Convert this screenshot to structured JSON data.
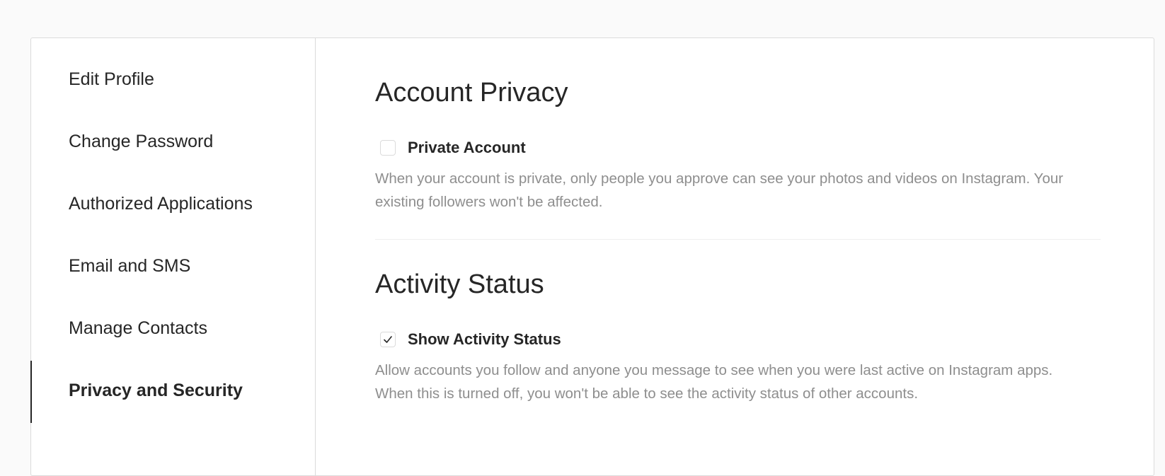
{
  "sidebar": {
    "items": [
      {
        "label": "Edit Profile"
      },
      {
        "label": "Change Password"
      },
      {
        "label": "Authorized Applications"
      },
      {
        "label": "Email and SMS"
      },
      {
        "label": "Manage Contacts"
      },
      {
        "label": "Privacy and Security",
        "active": true
      }
    ]
  },
  "account_privacy": {
    "title": "Account Privacy",
    "checkbox_label": "Private Account",
    "checked": false,
    "description": "When your account is private, only people you approve can see your photos and videos on Instagram. Your existing followers won't be affected."
  },
  "activity_status": {
    "title": "Activity Status",
    "checkbox_label": "Show Activity Status",
    "checked": true,
    "description": "Allow accounts you follow and anyone you message to see when you were last active on Instagram apps. When this is turned off, you won't be able to see the activity status of other accounts."
  },
  "icons": {
    "checkmark": "check-icon"
  },
  "colors": {
    "text": "#262626",
    "muted": "#8e8e8e",
    "border": "#dbdbdb"
  }
}
